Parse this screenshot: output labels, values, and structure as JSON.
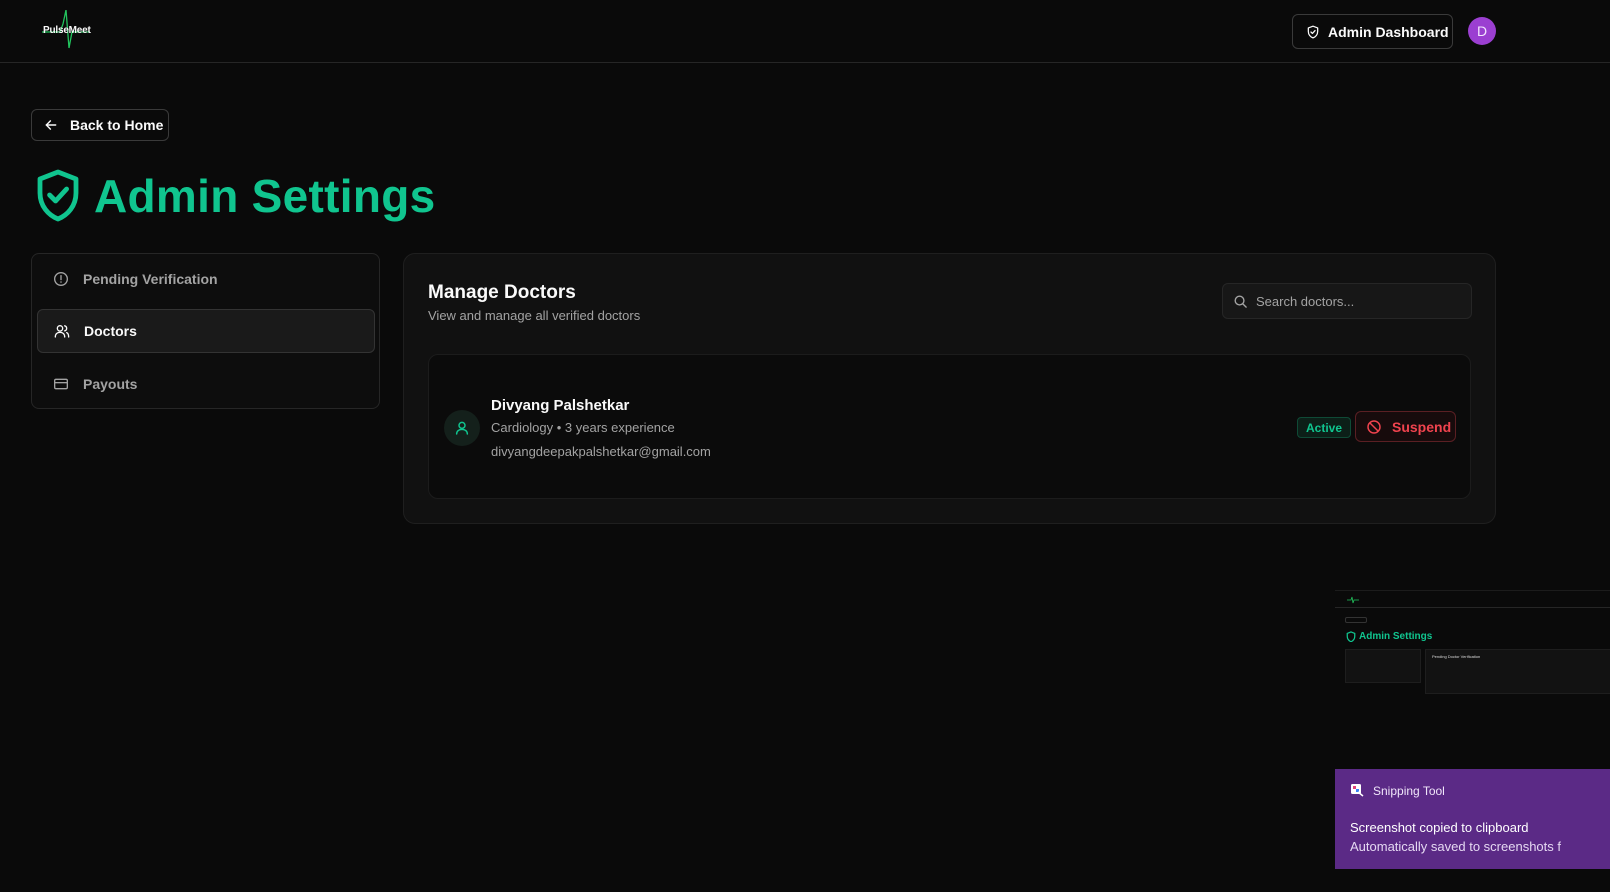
{
  "header": {
    "logo_text": "PulseMeet",
    "admin_dashboard_label": "Admin Dashboard",
    "avatar_initial": "D",
    "avatar_color": "#9b3fd1"
  },
  "back_label": "Back to Home",
  "page_title": "Admin Settings",
  "accent_color": "#10c58f",
  "sidebar": {
    "items": [
      {
        "label": "Pending Verification",
        "icon": "alert-circle-icon",
        "active": false
      },
      {
        "label": "Doctors",
        "icon": "users-icon",
        "active": true
      },
      {
        "label": "Payouts",
        "icon": "credit-card-icon",
        "active": false
      }
    ]
  },
  "main": {
    "title": "Manage Doctors",
    "subtitle": "View and manage all verified doctors",
    "search_placeholder": "Search doctors...",
    "doctors": [
      {
        "name": "Divyang Palshetkar",
        "meta": "Cardiology • 3 years experience",
        "email": "divyangdeepakpalshetkar@gmail.com",
        "status": "Active",
        "action_label": "Suspend"
      }
    ]
  },
  "overlay": {
    "thumbnail_title": "Admin Settings",
    "thumbnail_panel_title": "Pending Doctor Verification",
    "toast_app": "Snipping Tool",
    "toast_message": "Screenshot copied to clipboard",
    "toast_detail": "Automatically saved to screenshots f"
  }
}
